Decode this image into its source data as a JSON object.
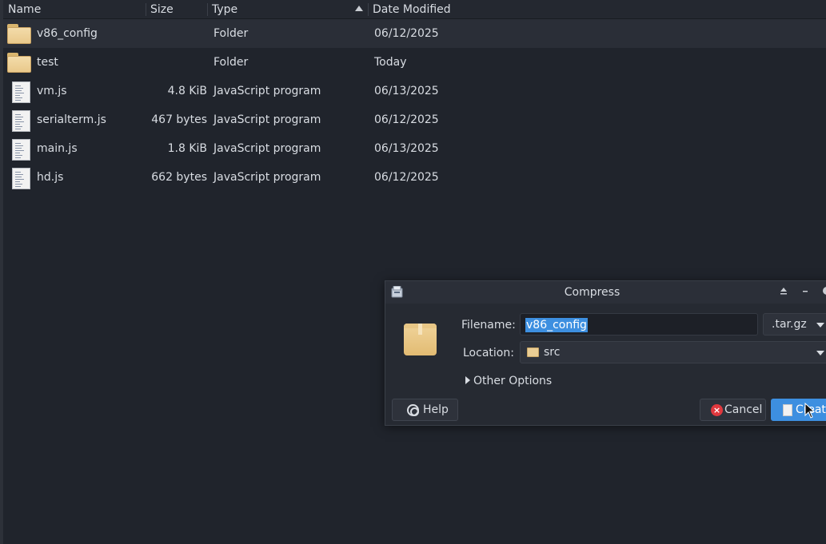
{
  "columns": {
    "name": "Name",
    "size": "Size",
    "type": "Type",
    "date": "Date Modified"
  },
  "files": [
    {
      "name": "v86_config",
      "size": "",
      "type": "Folder",
      "date": "06/12/2025",
      "icon": "folder-icon",
      "selected": true
    },
    {
      "name": "test",
      "size": "",
      "type": "Folder",
      "date": "Today",
      "icon": "folder-icon"
    },
    {
      "name": "vm.js",
      "size": "4.8 KiB",
      "type": "JavaScript program",
      "date": "06/13/2025",
      "icon": "javascript-file-icon"
    },
    {
      "name": "serialterm.js",
      "size": "467 bytes",
      "type": "JavaScript program",
      "date": "06/12/2025",
      "icon": "javascript-file-icon"
    },
    {
      "name": "main.js",
      "size": "1.8 KiB",
      "type": "JavaScript program",
      "date": "06/13/2025",
      "icon": "javascript-file-icon"
    },
    {
      "name": "hd.js",
      "size": "662 bytes",
      "type": "JavaScript program",
      "date": "06/12/2025",
      "icon": "javascript-file-icon"
    }
  ],
  "dialog": {
    "title": "Compress",
    "filename_label": "Filename:",
    "filename_value": "v86_config",
    "extension": ".tar.gz",
    "location_label": "Location:",
    "location_value": "src",
    "other_options": "Other Options",
    "help_label": "Help",
    "cancel_label": "Cancel",
    "create_label": "Create"
  },
  "colors": {
    "accent": "#3d8fe0",
    "background": "#20242c",
    "cancel_red": "#e0383e"
  }
}
